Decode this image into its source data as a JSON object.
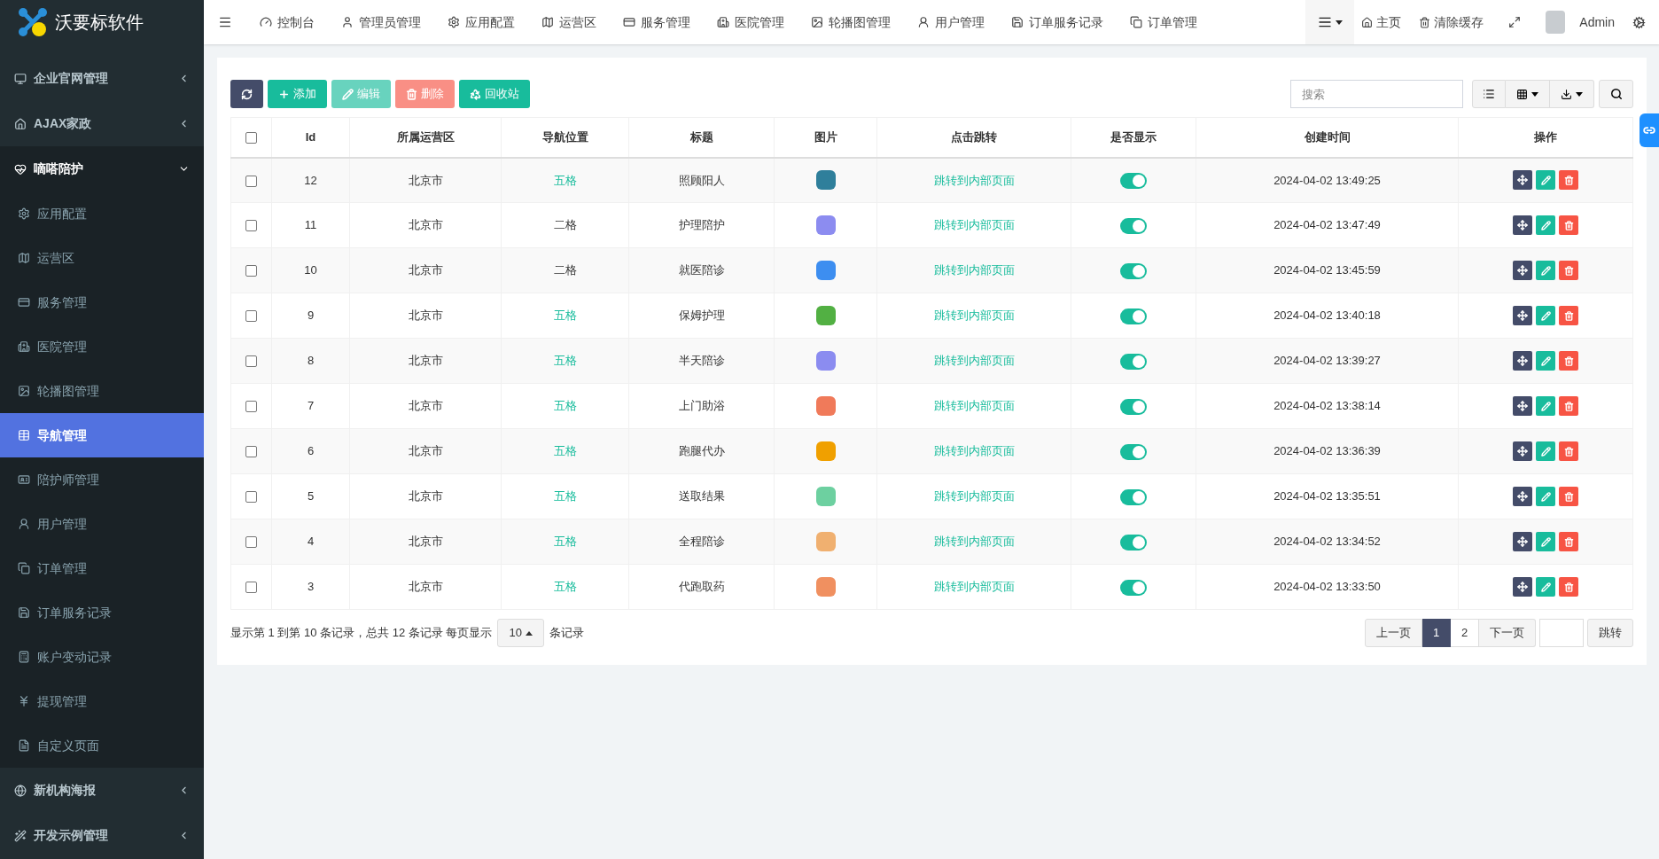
{
  "app": {
    "logo_text": "沃要标软件"
  },
  "top_nav": [
    {
      "label": "控制台"
    },
    {
      "label": "管理员管理"
    },
    {
      "label": "应用配置"
    },
    {
      "label": "运营区"
    },
    {
      "label": "服务管理"
    },
    {
      "label": "医院管理"
    },
    {
      "label": "轮播图管理"
    },
    {
      "label": "用户管理"
    },
    {
      "label": "订单服务记录"
    },
    {
      "label": "订单管理"
    }
  ],
  "top_right": {
    "home": "主页",
    "clear_cache": "清除缓存",
    "user": "Admin"
  },
  "sidebar": {
    "items": [
      {
        "label": "企业官网管理",
        "expanded": false
      },
      {
        "label": "AJAX家政",
        "expanded": false
      },
      {
        "label": "嘀嗒陪护",
        "expanded": true,
        "children": [
          {
            "label": "应用配置",
            "selected": false
          },
          {
            "label": "运营区",
            "selected": false
          },
          {
            "label": "服务管理",
            "selected": false
          },
          {
            "label": "医院管理",
            "selected": false
          },
          {
            "label": "轮播图管理",
            "selected": false
          },
          {
            "label": "导航管理",
            "selected": true
          },
          {
            "label": "陪护师管理",
            "selected": false
          },
          {
            "label": "用户管理",
            "selected": false
          },
          {
            "label": "订单管理",
            "selected": false
          },
          {
            "label": "订单服务记录",
            "selected": false
          },
          {
            "label": "账户变动记录",
            "selected": false
          },
          {
            "label": "提现管理",
            "selected": false
          },
          {
            "label": "自定义页面",
            "selected": false
          }
        ]
      },
      {
        "label": "新机构海报",
        "expanded": false
      },
      {
        "label": "开发示例管理",
        "expanded": false
      }
    ]
  },
  "toolbar": {
    "buttons": [
      {
        "kind": "refresh",
        "disabled": false
      },
      {
        "kind": "add",
        "label": "添加",
        "disabled": false
      },
      {
        "kind": "edit",
        "label": "编辑",
        "disabled": true
      },
      {
        "kind": "delete",
        "label": "删除",
        "disabled": true
      },
      {
        "kind": "recycle",
        "label": "回收站",
        "disabled": false
      }
    ],
    "search": {
      "placeholder": "搜索"
    }
  },
  "table": {
    "select_all": {
      "checked": false
    },
    "columns": [
      "Id",
      "所属运营区",
      "导航位置",
      "标题",
      "图片",
      "点击跳转",
      "是否显示",
      "创建时间",
      "操作"
    ],
    "rows": [
      {
        "checked": false,
        "id": "12",
        "region": "北京市",
        "position": {
          "text": "五格",
          "highlighted": true
        },
        "title": "照顾阳人",
        "image": {
          "color": "#2f7f9b"
        },
        "link": "跳转到内部页面",
        "visible": true,
        "created": "2024-04-02 13:49:25"
      },
      {
        "checked": false,
        "id": "11",
        "region": "北京市",
        "position": {
          "text": "二格",
          "highlighted": false
        },
        "title": "护理陪护",
        "image": {
          "color": "#8c8cf0"
        },
        "link": "跳转到内部页面",
        "visible": true,
        "created": "2024-04-02 13:47:49"
      },
      {
        "checked": false,
        "id": "10",
        "region": "北京市",
        "position": {
          "text": "二格",
          "highlighted": false
        },
        "title": "就医陪诊",
        "image": {
          "color": "#3d8ef0"
        },
        "link": "跳转到内部页面",
        "visible": true,
        "created": "2024-04-02 13:45:59"
      },
      {
        "checked": false,
        "id": "9",
        "region": "北京市",
        "position": {
          "text": "五格",
          "highlighted": true
        },
        "title": "保姆护理",
        "image": {
          "color": "#52b043"
        },
        "link": "跳转到内部页面",
        "visible": true,
        "created": "2024-04-02 13:40:18"
      },
      {
        "checked": false,
        "id": "8",
        "region": "北京市",
        "position": {
          "text": "五格",
          "highlighted": true
        },
        "title": "半天陪诊",
        "image": {
          "color": "#8b8cf0"
        },
        "link": "跳转到内部页面",
        "visible": true,
        "created": "2024-04-02 13:39:27"
      },
      {
        "checked": false,
        "id": "7",
        "region": "北京市",
        "position": {
          "text": "五格",
          "highlighted": true
        },
        "title": "上门助浴",
        "image": {
          "color": "#f07a5a"
        },
        "link": "跳转到内部页面",
        "visible": true,
        "created": "2024-04-02 13:38:14"
      },
      {
        "checked": false,
        "id": "6",
        "region": "北京市",
        "position": {
          "text": "五格",
          "highlighted": true
        },
        "title": "跑腿代办",
        "image": {
          "color": "#f0a000"
        },
        "link": "跳转到内部页面",
        "visible": true,
        "created": "2024-04-02 13:36:39"
      },
      {
        "checked": false,
        "id": "5",
        "region": "北京市",
        "position": {
          "text": "五格",
          "highlighted": true
        },
        "title": "送取结果",
        "image": {
          "color": "#6dd0a0"
        },
        "link": "跳转到内部页面",
        "visible": true,
        "created": "2024-04-02 13:35:51"
      },
      {
        "checked": false,
        "id": "4",
        "region": "北京市",
        "position": {
          "text": "五格",
          "highlighted": true
        },
        "title": "全程陪诊",
        "image": {
          "color": "#f0b070"
        },
        "link": "跳转到内部页面",
        "visible": true,
        "created": "2024-04-02 13:34:52"
      },
      {
        "checked": false,
        "id": "3",
        "region": "北京市",
        "position": {
          "text": "五格",
          "highlighted": true
        },
        "title": "代跑取药",
        "image": {
          "color": "#f09060"
        },
        "link": "跳转到内部页面",
        "visible": true,
        "created": "2024-04-02 13:33:50"
      }
    ]
  },
  "pagination": {
    "summary": "显示第 1 到第 10 条记录，总共 12 条记录 每页显示",
    "page_size": "10",
    "suffix": "条记录",
    "prev": "上一页",
    "pages": [
      {
        "label": "1",
        "selected": true
      },
      {
        "label": "2",
        "selected": false
      }
    ],
    "next": "下一页",
    "jump": "跳转"
  }
}
